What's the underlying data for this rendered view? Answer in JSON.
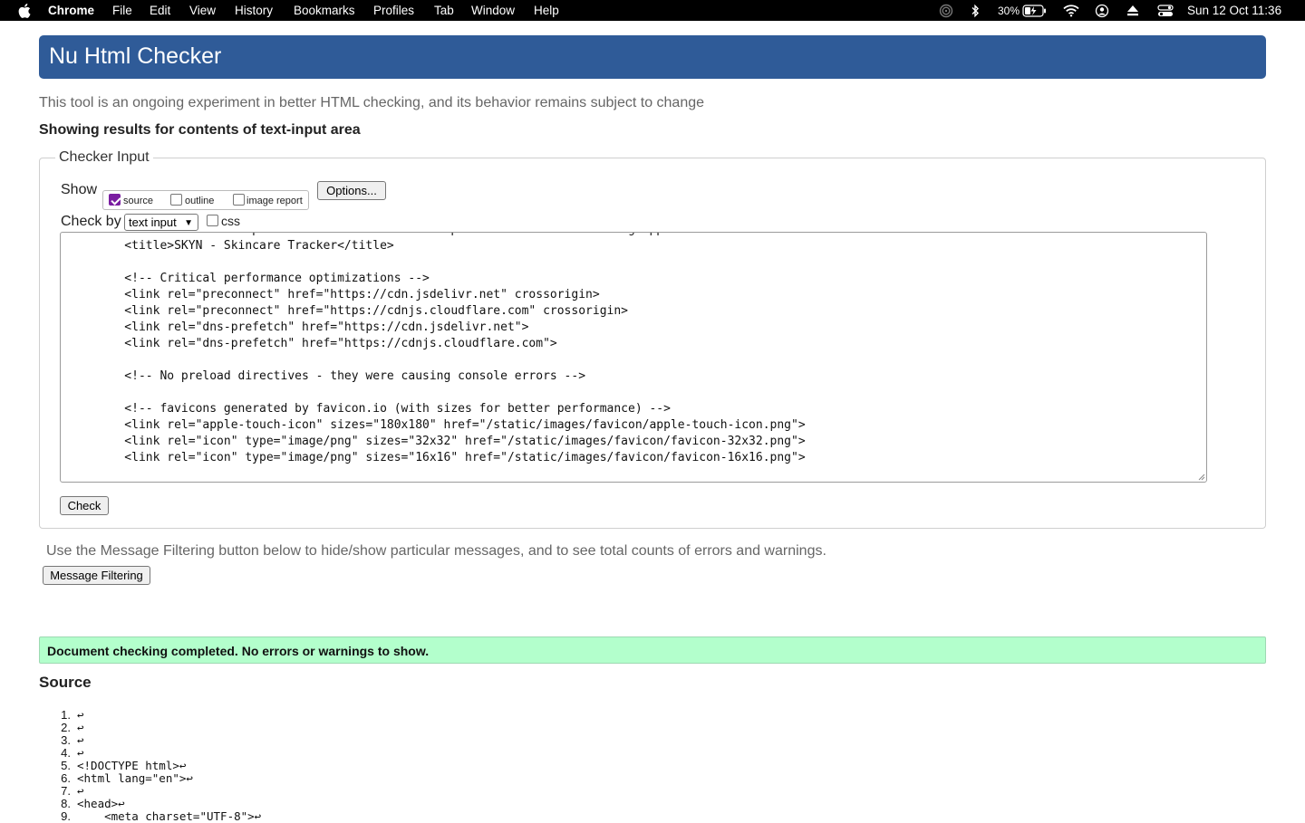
{
  "menubar": {
    "apple_icon": "apple-logo-icon",
    "app_name": "Chrome",
    "menus": [
      "File",
      "Edit",
      "View",
      "History",
      "Bookmarks",
      "Profiles",
      "Tab",
      "Window",
      "Help"
    ],
    "battery_percent": "30%",
    "datetime": "Sun 12 Oct  11:36"
  },
  "header": {
    "title": "Nu Html Checker"
  },
  "intro_text": "This tool is an ongoing experiment in better HTML checking, and its behavior remains subject to change",
  "showing_text": "Showing results for contents of text-input area",
  "checker_input": {
    "legend": "Checker Input",
    "show_label": "Show",
    "show_options": [
      {
        "label": "source",
        "checked": true
      },
      {
        "label": "outline",
        "checked": false
      },
      {
        "label": "image report",
        "checked": false
      }
    ],
    "options_button": "Options...",
    "check_by_label": "Check by",
    "check_by_value": "text input",
    "css_label": "css",
    "css_checked": false,
    "source_text": "    <meta name=\"description\" content=\"SKYN - Your personal skincare tracking application\">\n    <title>SKYN - Skincare Tracker</title>\n\n    <!-- Critical performance optimizations -->\n    <link rel=\"preconnect\" href=\"https://cdn.jsdelivr.net\" crossorigin>\n    <link rel=\"preconnect\" href=\"https://cdnjs.cloudflare.com\" crossorigin>\n    <link rel=\"dns-prefetch\" href=\"https://cdn.jsdelivr.net\">\n    <link rel=\"dns-prefetch\" href=\"https://cdnjs.cloudflare.com\">\n\n    <!-- No preload directives - they were causing console errors -->\n\n    <!-- favicons generated by favicon.io (with sizes for better performance) -->\n    <link rel=\"apple-touch-icon\" sizes=\"180x180\" href=\"/static/images/favicon/apple-touch-icon.png\">\n    <link rel=\"icon\" type=\"image/png\" sizes=\"32x32\" href=\"/static/images/favicon/favicon-32x32.png\">\n    <link rel=\"icon\" type=\"image/png\" sizes=\"16x16\" href=\"/static/images/favicon/favicon-16x16.png\">",
    "check_button": "Check"
  },
  "filter_text": "Use the Message Filtering button below to hide/show particular messages, and to see total counts of errors and warnings.",
  "filter_button": "Message Filtering",
  "success_message": "Document checking completed. No errors or warnings to show.",
  "source_heading": "Source",
  "source_lines": [
    {
      "n": "1.",
      "text": "↩"
    },
    {
      "n": "2.",
      "text": "↩"
    },
    {
      "n": "3.",
      "text": "↩"
    },
    {
      "n": "4.",
      "text": "↩"
    },
    {
      "n": "5.",
      "text": "<!DOCTYPE html>↩"
    },
    {
      "n": "6.",
      "text": "<html lang=\"en\">↩"
    },
    {
      "n": "7.",
      "text": "↩"
    },
    {
      "n": "8.",
      "text": "<head>↩"
    },
    {
      "n": "9.",
      "text": "    <meta charset=\"UTF-8\">↩"
    }
  ]
}
